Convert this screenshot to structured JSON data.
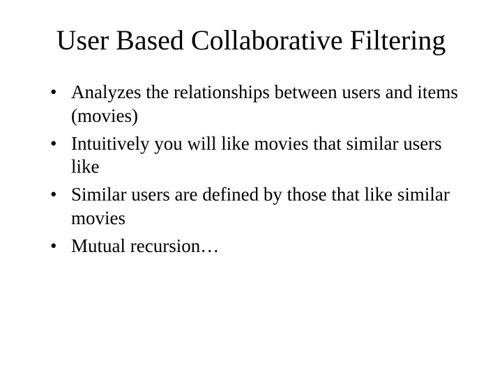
{
  "title": "User Based Collaborative Filtering",
  "bullets": {
    "b0": "Analyzes the relationships between users and items (movies)",
    "b1": "Intuitively you will like movies that similar users like",
    "b2": "Similar users are defined by those that like similar movies",
    "b3": "Mutual recursion…"
  }
}
